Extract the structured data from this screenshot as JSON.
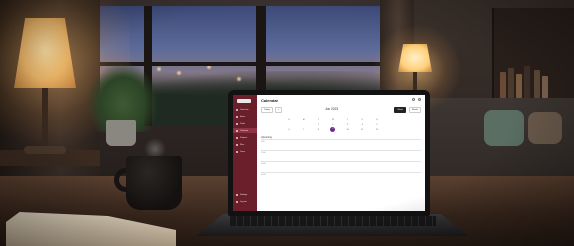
{
  "app": {
    "title": "Calendar",
    "month_label": "Jun 2023",
    "today_label": "Today",
    "prev_label": "<",
    "week_label": "Week",
    "month_button": "Month",
    "events_heading": "Upcoming"
  },
  "sidebar": {
    "items": [
      {
        "label": "Overview"
      },
      {
        "label": "Inbox"
      },
      {
        "label": "Tasks"
      },
      {
        "label": "Calendar"
      },
      {
        "label": "Projects"
      },
      {
        "label": "Files"
      },
      {
        "label": "Team"
      }
    ],
    "footer_items": [
      {
        "label": "Settings"
      },
      {
        "label": "Log out"
      }
    ]
  },
  "calendar": {
    "weekdays": [
      "S",
      "M",
      "T",
      "W",
      "T",
      "F",
      "S"
    ],
    "rows": [
      [
        "",
        "",
        "1",
        "2",
        "3",
        "4",
        "5"
      ],
      [
        "6",
        "7",
        "8",
        "9",
        "10",
        "11",
        "12"
      ]
    ],
    "today": "9"
  },
  "events": [
    {
      "time": "9:00"
    },
    {
      "time": "11:00"
    },
    {
      "time": "13:00"
    },
    {
      "time": "15:00"
    }
  ],
  "colors": {
    "sidebar": "#6a1f2a",
    "today_highlight": "#6a2a8a",
    "lamp_glow": "#ffcf7a",
    "desk": "#3a281d"
  }
}
